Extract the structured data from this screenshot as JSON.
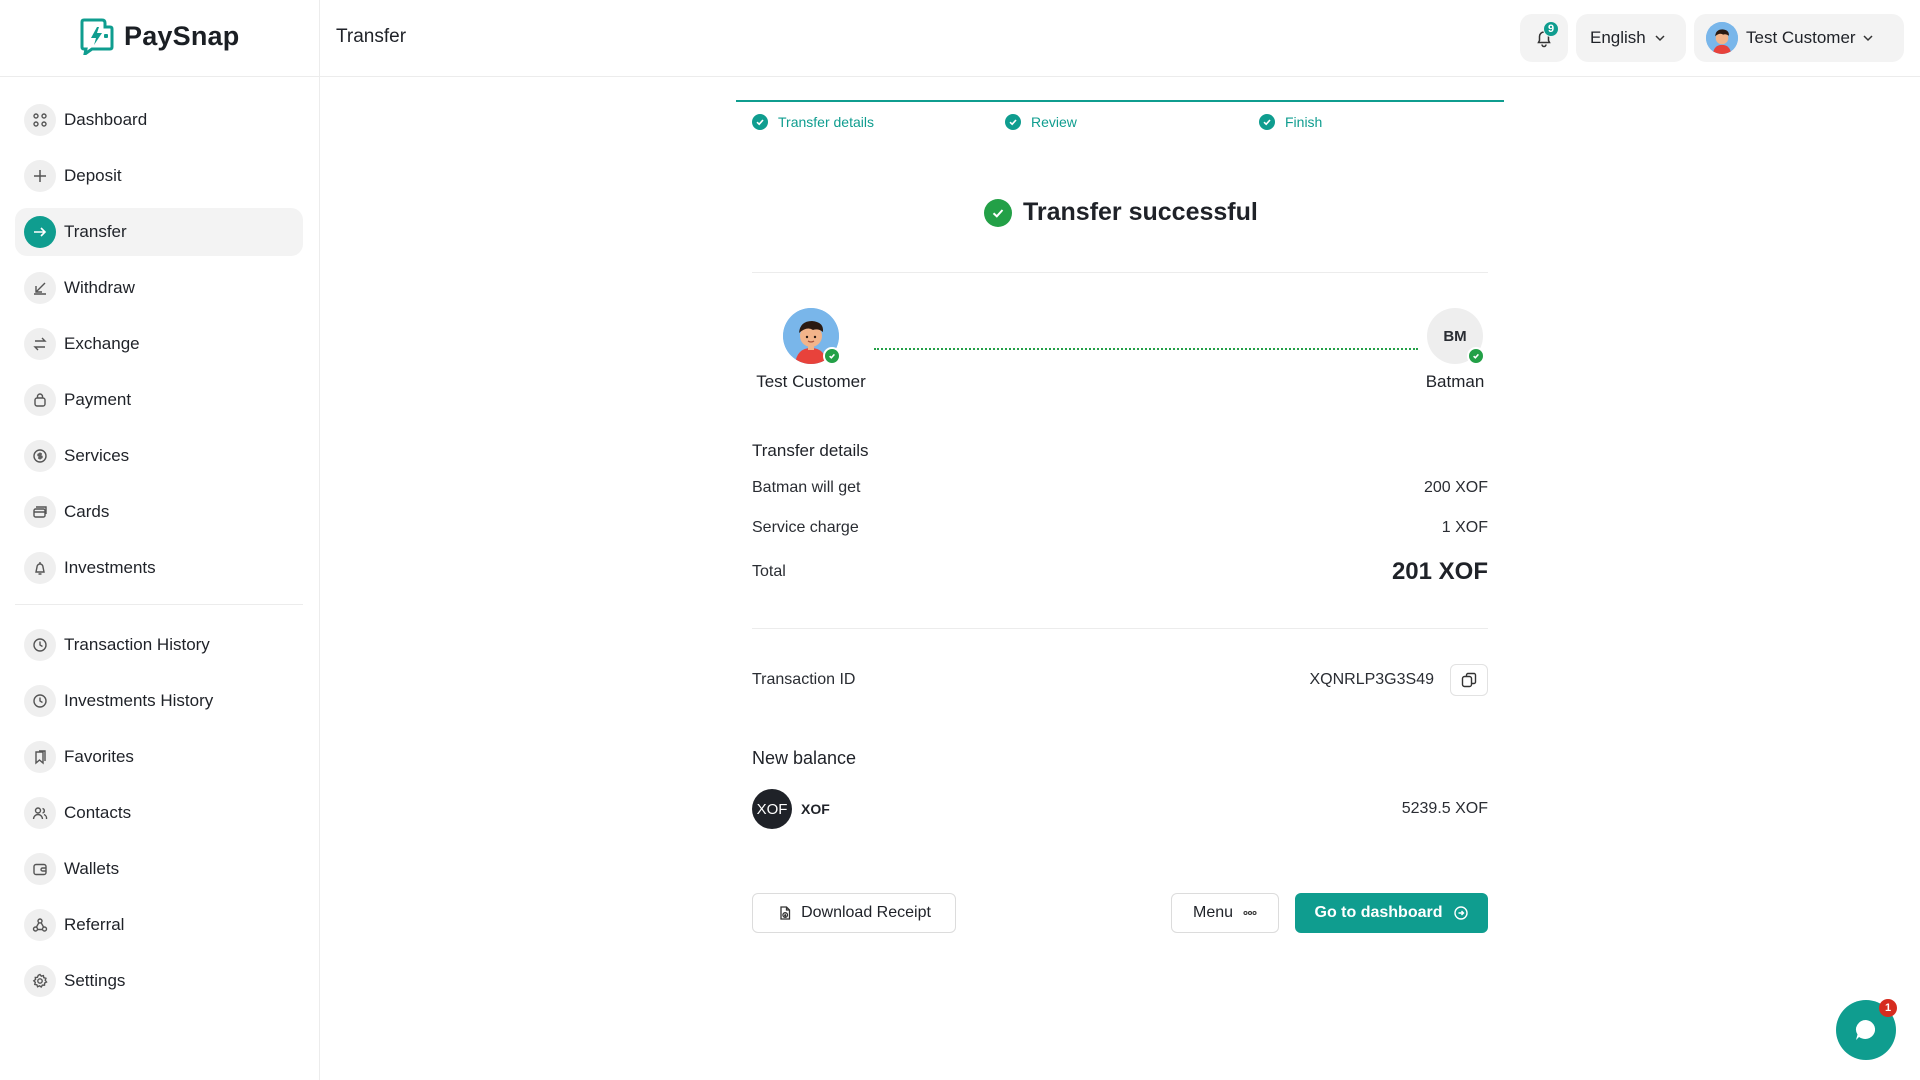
{
  "app": {
    "name": "PaySnap"
  },
  "header": {
    "title": "Transfer",
    "notifications_count": "9",
    "language": "English",
    "user_name": "Test Customer"
  },
  "sidebar": {
    "items": [
      {
        "label": "Dashboard",
        "icon": "grid-icon"
      },
      {
        "label": "Deposit",
        "icon": "plus-icon"
      },
      {
        "label": "Transfer",
        "icon": "arrow-right-icon",
        "active": true
      },
      {
        "label": "Withdraw",
        "icon": "arrow-down-left-icon"
      },
      {
        "label": "Exchange",
        "icon": "exchange-icon"
      },
      {
        "label": "Payment",
        "icon": "bag-icon"
      },
      {
        "label": "Services",
        "icon": "coin-icon"
      },
      {
        "label": "Cards",
        "icon": "cards-icon"
      },
      {
        "label": "Investments",
        "icon": "bell-plant-icon"
      }
    ],
    "secondary_items": [
      {
        "label": "Transaction History",
        "icon": "clock-icon"
      },
      {
        "label": "Investments History",
        "icon": "clock-icon"
      },
      {
        "label": "Favorites",
        "icon": "bookmark-icon"
      },
      {
        "label": "Contacts",
        "icon": "users-icon"
      },
      {
        "label": "Wallets",
        "icon": "wallet-icon"
      },
      {
        "label": "Referral",
        "icon": "referral-icon"
      },
      {
        "label": "Settings",
        "icon": "gear-icon"
      }
    ]
  },
  "steps": [
    {
      "label": "Transfer details",
      "done": true
    },
    {
      "label": "Review",
      "done": true
    },
    {
      "label": "Finish",
      "done": true
    }
  ],
  "result": {
    "title": "Transfer successful",
    "sender": "Test Customer",
    "receiver": "Batman",
    "receiver_initials": "BM"
  },
  "details": {
    "heading": "Transfer details",
    "recipient_gets_label": "Batman will get",
    "recipient_gets_value": "200 XOF",
    "service_charge_label": "Service charge",
    "service_charge_value": "1 XOF",
    "total_label": "Total",
    "total_value": "201 XOF",
    "transaction_id_label": "Transaction ID",
    "transaction_id_value": "XQNRLP3G3S49"
  },
  "new_balance": {
    "heading": "New balance",
    "currency_badge": "XOF",
    "currency_code": "XOF",
    "value": "5239.5 XOF"
  },
  "actions": {
    "download_receipt": "Download Receipt",
    "menu": "Menu",
    "go_to_dashboard": "Go to dashboard"
  },
  "chat": {
    "unread": "1"
  },
  "colors": {
    "accent": "#0f9d8f",
    "success": "#23a047",
    "badge_red": "#d62c1f"
  }
}
